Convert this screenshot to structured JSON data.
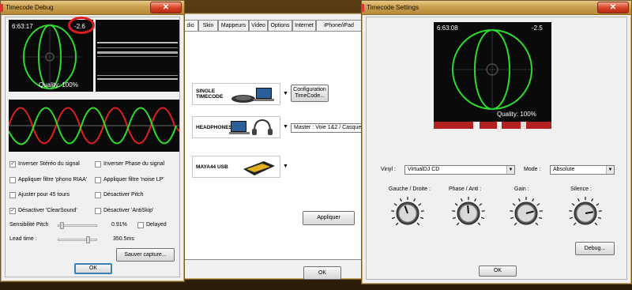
{
  "debug_window": {
    "title": "Timecode Debug",
    "scope": {
      "time": "6:63:17",
      "pitch": "-2.6",
      "quality": "Quality: 100%"
    },
    "checkboxes": [
      {
        "label": "Inverser Stéréo du signal",
        "checked": true
      },
      {
        "label": "Inverser Phase du signal",
        "checked": false
      },
      {
        "label": "Appliquer filtre 'phono RIAA'",
        "checked": false
      },
      {
        "label": "Appliquer filtre 'noise LP'",
        "checked": false
      },
      {
        "label": "Ajuster pour 45 tours",
        "checked": false
      },
      {
        "label": "Désactiver Pitch",
        "checked": false
      },
      {
        "label": "Désactiver 'ClearSound'",
        "checked": true
      },
      {
        "label": "Désactiver 'AntiSkip'",
        "checked": false
      }
    ],
    "sensibilite_label": "Sensibilité Pitch",
    "sensibilite_value": "0.91%",
    "delayed_label": "Delayed",
    "lead_label": "Lead time :",
    "lead_value": "350.5ms",
    "save_button": "Sauver capture...",
    "ok_button": "OK"
  },
  "config_window": {
    "tabs": [
      "dio",
      "Skin",
      "Mappeurs",
      "Video",
      "Options",
      "Internet",
      "iPhone/iPad"
    ],
    "devices": [
      {
        "label": "SINGLE\nTIMECODE",
        "icon": "turntable-laptop-icon"
      },
      {
        "label": "HEADPHONES",
        "icon": "headphones-laptop-icon"
      },
      {
        "label": "MAYA44 USB",
        "icon": "usb-interface-icon"
      }
    ],
    "config_button": "Configuration\nTimeCode...",
    "master_value": "Master : Voie 1&2 / Casque",
    "apply_button": "Appliquer",
    "ok_button": "OK"
  },
  "settings_window": {
    "title": "Timecode Settings",
    "scope": {
      "time": "6:63:08",
      "pitch": "-2.5",
      "quality": "Quality: 100%"
    },
    "vinyl_label": "Vinyl :",
    "vinyl_value": "VirtualDJ CD",
    "mode_label": "Mode :",
    "mode_value": "Absolute",
    "knobs": [
      {
        "label": "Gauche / Droite :"
      },
      {
        "label": "Phase / Anti :"
      },
      {
        "label": "Gain :"
      },
      {
        "label": "Silence :"
      }
    ],
    "debug_button": "Debug...",
    "ok_button": "OK"
  },
  "colors": {
    "scope_green": "#2ddc2d",
    "signal_red": "#e02020",
    "annotation_red": "#e11b1b"
  }
}
